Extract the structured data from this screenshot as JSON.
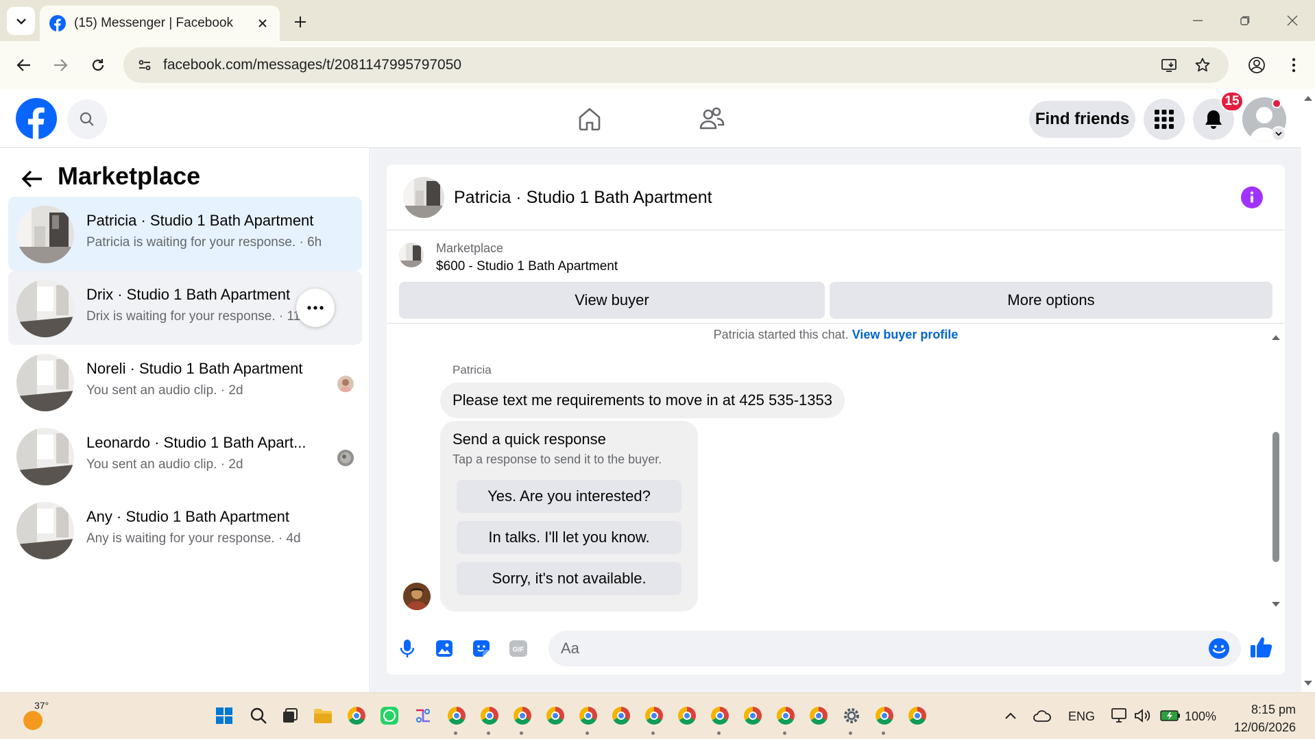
{
  "browser": {
    "tab_title": "(15) Messenger | Facebook",
    "url": "facebook.com/messages/t/2081147995797050",
    "icons": [
      "tab-list-icon",
      "facebook-favicon",
      "close-icon",
      "plus-icon",
      "minimize-icon",
      "restore-icon",
      "window-close-icon",
      "back-icon",
      "forward-icon",
      "reload-icon",
      "site-info-icon",
      "install-app-icon",
      "star-icon",
      "profile-icon",
      "kebab-icon"
    ]
  },
  "header": {
    "find_friends_label": "Find friends",
    "notification_count": "15",
    "brand_color": "#0866ff"
  },
  "sidebar": {
    "title": "Marketplace",
    "conversations": [
      {
        "name": "Patricia · Studio 1 Bath Apartment",
        "preview": "Patricia is waiting for your response. · 6h",
        "selected": true
      },
      {
        "name": "Drix · Studio 1 Bath Apartment",
        "preview": "Drix is waiting for your response. · 11",
        "hovered": true
      },
      {
        "name": "Noreli · Studio 1 Bath Apartment",
        "preview": "You sent an audio clip. · 2d"
      },
      {
        "name": "Leonardo · Studio 1 Bath Apart...",
        "preview": "You sent an audio clip. · 2d"
      },
      {
        "name": "Any · Studio 1 Bath Apartment",
        "preview": "Any is waiting for your response. · 4d"
      }
    ]
  },
  "chat": {
    "title": "Patricia · Studio 1 Bath Apartment",
    "listing_label": "Marketplace",
    "listing_title": "$600 - Studio 1 Bath Apartment",
    "view_buyer_label": "View buyer",
    "more_options_label": "More options",
    "started_text": "Patricia started this chat.",
    "view_buyer_profile_link": "View buyer profile",
    "sender_name": "Patricia",
    "message": "Please text me requirements to move in at 425 535-1353",
    "quick_response": {
      "title": "Send a quick response",
      "subtitle": "Tap a response to send it to the buyer.",
      "options": [
        "Yes. Are you interested?",
        "In talks. I'll let you know.",
        "Sorry, it's not available."
      ]
    },
    "input_placeholder": "Aa",
    "accent_color": "#a033ff"
  },
  "taskbar": {
    "temperature": "37°",
    "language": "ENG",
    "battery": "100%",
    "time": "8:15 pm",
    "date": "12/06/2026"
  }
}
